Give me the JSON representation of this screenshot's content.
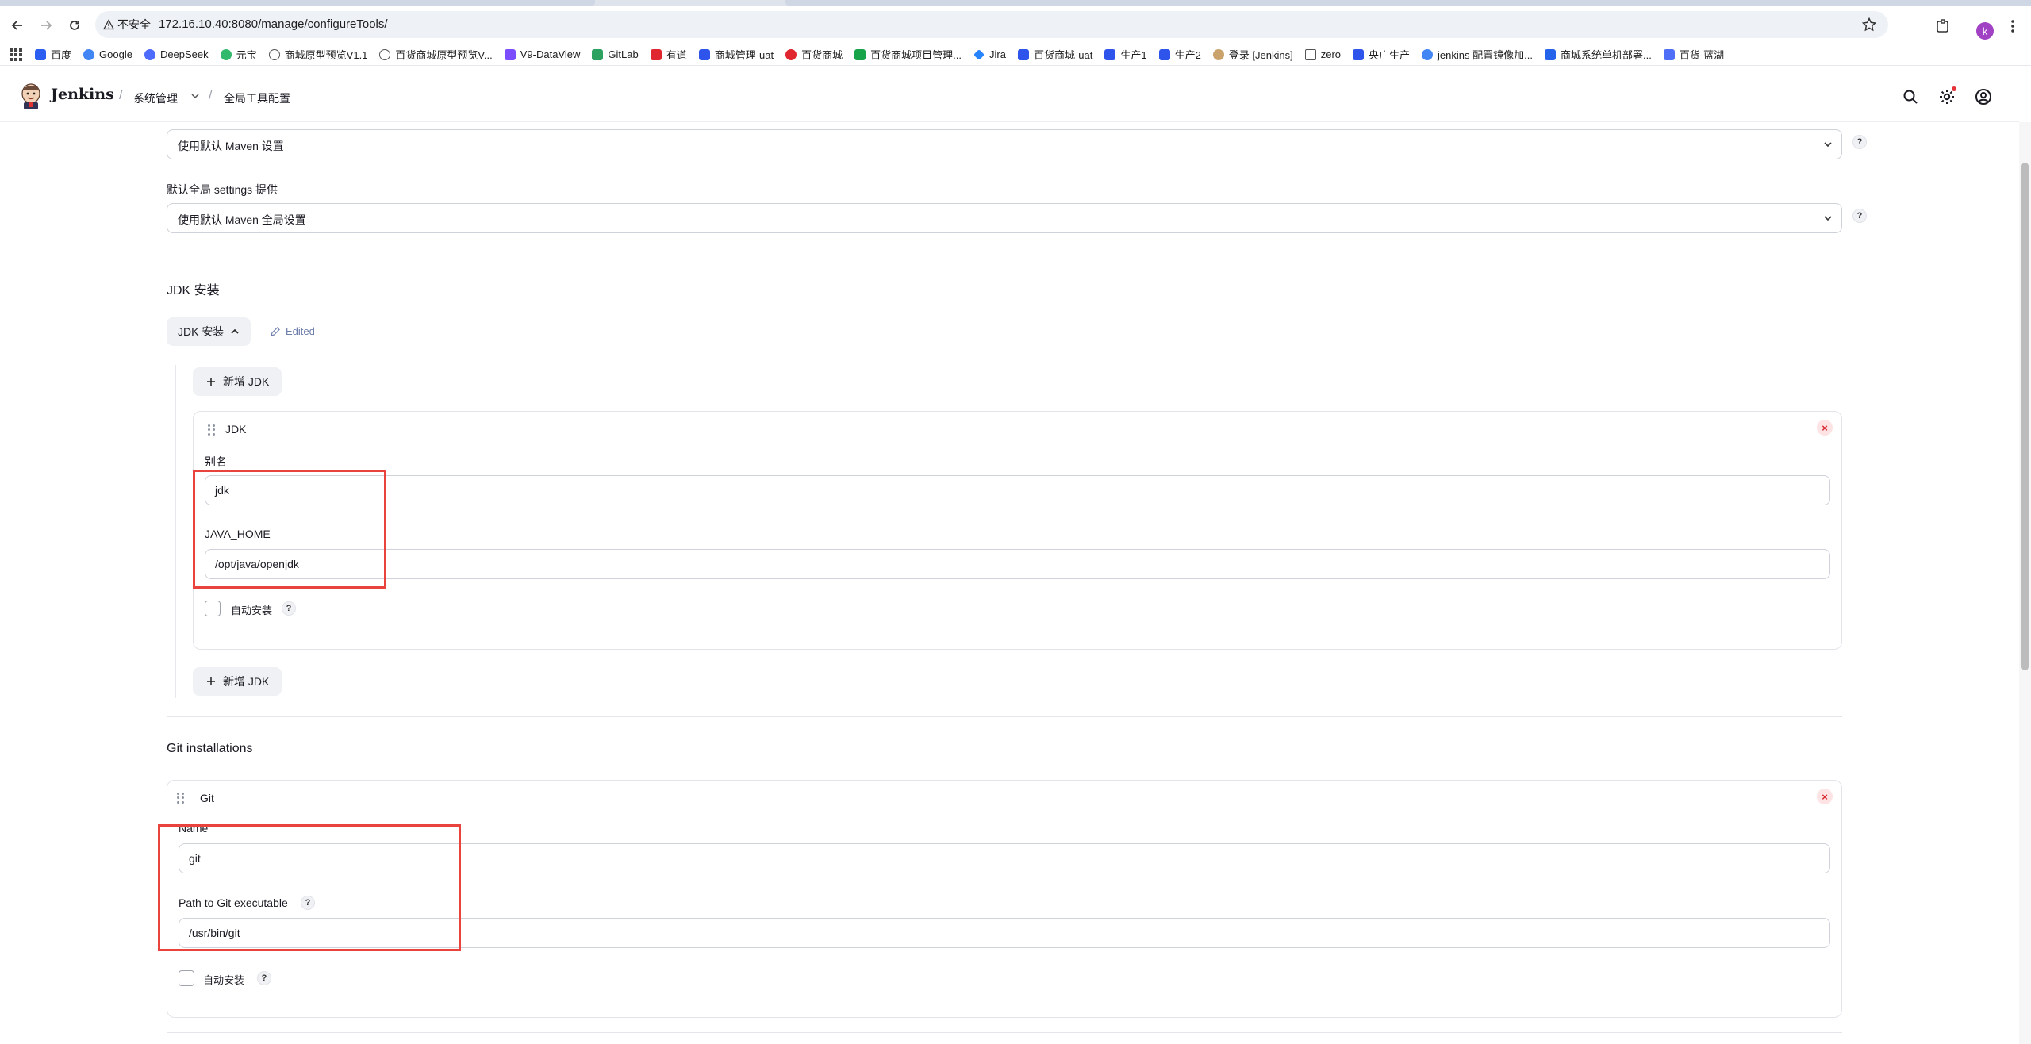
{
  "browser": {
    "security_label": "不安全",
    "url": "172.16.10.40:8080/manage/configureTools/",
    "profile_initial": "k"
  },
  "bookmarks": [
    {
      "label": "百度",
      "color": "#2b5ef0"
    },
    {
      "label": "Google",
      "color": "#4285f4"
    },
    {
      "label": "DeepSeek",
      "color": "#4d6bfe"
    },
    {
      "label": "元宝",
      "color": "#32b96b"
    },
    {
      "label": "商城原型预览V1.1",
      "color": "#555555"
    },
    {
      "label": "百货商城原型预览V...",
      "color": "#555555"
    },
    {
      "label": "V9-DataView",
      "color": "#7c4dff"
    },
    {
      "label": "GitLab",
      "color": "#2da160"
    },
    {
      "label": "有道",
      "color": "#e0262f"
    },
    {
      "label": "商城管理-uat",
      "color": "#2f54eb"
    },
    {
      "label": "百货商城",
      "color": "#e0262f"
    },
    {
      "label": "百货商城项目管理...",
      "color": "#16a34a"
    },
    {
      "label": "Jira",
      "color": "#2684ff"
    },
    {
      "label": "百货商城-uat",
      "color": "#2f54eb"
    },
    {
      "label": "生产1",
      "color": "#2f54eb"
    },
    {
      "label": "生产2",
      "color": "#2f54eb"
    },
    {
      "label": "登录 [Jenkins]",
      "color": "#c9a36b"
    },
    {
      "label": "zero",
      "color": "#555555"
    },
    {
      "label": "央广生产",
      "color": "#2f54eb"
    },
    {
      "label": "jenkins 配置镜像加...",
      "color": "#4285f4"
    },
    {
      "label": "商城系统单机部署...",
      "color": "#2563eb"
    },
    {
      "label": "百货-蓝湖",
      "color": "#4f6ef7"
    }
  ],
  "header": {
    "app_name": "Jenkins",
    "crumb_manage": "系统管理",
    "crumb_tools": "全局工具配置"
  },
  "maven": {
    "settings_value": "使用默认 Maven 设置",
    "global_settings_label": "默认全局 settings 提供",
    "global_settings_value": "使用默认 Maven 全局设置"
  },
  "jdk": {
    "section_title": "JDK 安装",
    "toggle_label": "JDK 安装",
    "edited_label": "Edited",
    "add_label": "新增 JDK",
    "card_title": "JDK",
    "alias_label": "别名",
    "alias_value": "jdk",
    "home_label": "JAVA_HOME",
    "home_value": "/opt/java/openjdk",
    "auto_install_label": "自动安装"
  },
  "git": {
    "section_title": "Git installations",
    "card_title": "Git",
    "name_label": "Name",
    "name_value": "git",
    "path_label": "Path to Git executable",
    "path_value": "/usr/bin/git",
    "auto_install_label": "自动安装"
  },
  "help_mark": "?",
  "close_mark": "×",
  "colors": {
    "annotation": "#e8443d",
    "link_muted": "#6e7dac",
    "remove": "#d8262d"
  }
}
